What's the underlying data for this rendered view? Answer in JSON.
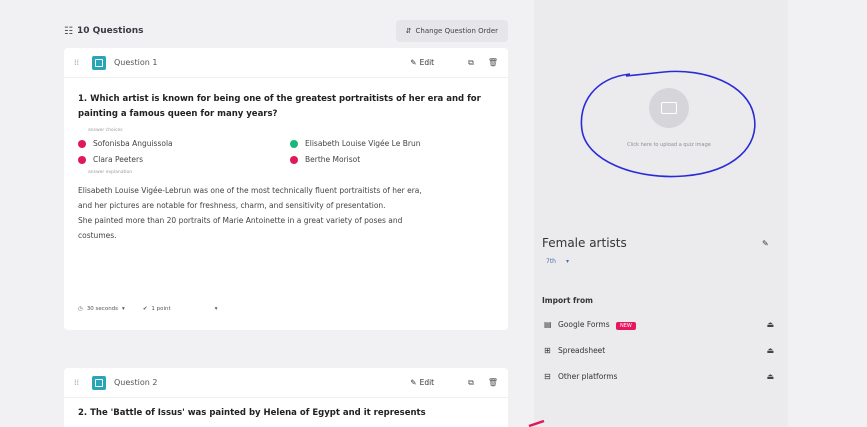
{
  "header": {
    "question_count": "10 Questions",
    "change_order_label": "Change Question Order"
  },
  "questions": [
    {
      "label": "Question 1",
      "edit_label": "Edit",
      "text": "1.   Which artist is known for being one of the greatest portraitists of her era and for painting a famous queen for many years?",
      "choices_label": "answer choices",
      "choices": [
        {
          "text": "Sofonisba Anguissola",
          "color": "#e0195a"
        },
        {
          "text": "Elisabeth Louise Vigée Le Brun",
          "color": "#1ab77a"
        },
        {
          "text": "Clara Peeters",
          "color": "#e0195a"
        },
        {
          "text": "Berthe Morisot",
          "color": "#e0195a"
        }
      ],
      "explanation_label": "answer explanation",
      "explanation": [
        "Elisabeth Louise Vigée-Lebrun was one of the most technically fluent portraitists of her era,",
        "and her pictures are notable for freshness, charm, and sensitivity of presentation.",
        "She painted more than 20 portraits of Marie Antoinette in a great variety of poses and",
        "costumes."
      ],
      "time": "30 seconds",
      "points": "1 point"
    },
    {
      "label": "Question 2",
      "edit_label": "Edit",
      "text": "2.   The 'Battle of Issus' was painted by Helena of Egypt and it represents"
    }
  ],
  "sidebar": {
    "upload_hint": "Click here to upload a quiz image",
    "quiz_title": "Female artists",
    "grade": "7th",
    "import_title": "Import from",
    "imports": [
      {
        "icon": "google-forms-icon",
        "label": "Google Forms",
        "badge": "NEW"
      },
      {
        "icon": "spreadsheet-icon",
        "label": "Spreadsheet"
      },
      {
        "icon": "grid-icon",
        "label": "Other platforms"
      }
    ]
  },
  "colors": {
    "accent_teal": "#29a5b8",
    "incorrect": "#e0195a",
    "correct": "#1ab77a",
    "annotation_blue": "#2b2bd6"
  }
}
